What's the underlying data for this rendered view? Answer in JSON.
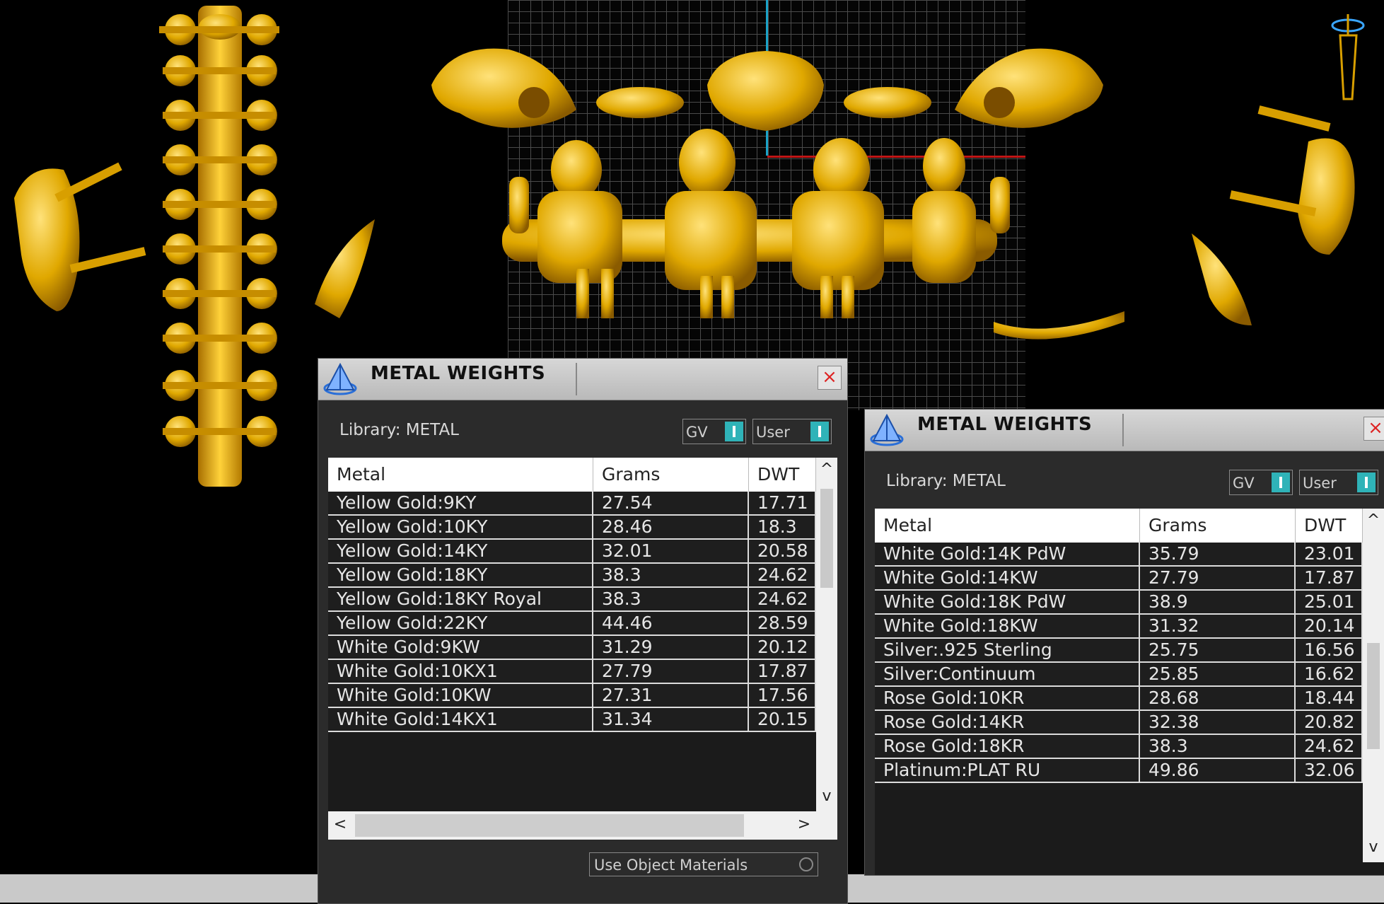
{
  "panels": [
    {
      "title": "METAL WEIGHTS",
      "library": "Library: METAL",
      "toggle_gv": "GV",
      "toggle_user": "User",
      "columns": [
        "Metal",
        "Grams",
        "DWT"
      ],
      "rows": [
        [
          "Yellow Gold:9KY",
          "27.54",
          "17.71"
        ],
        [
          "Yellow Gold:10KY",
          "28.46",
          "18.3"
        ],
        [
          "Yellow Gold:14KY",
          "32.01",
          "20.58"
        ],
        [
          "Yellow Gold:18KY",
          "38.3",
          "24.62"
        ],
        [
          "Yellow Gold:18KY Royal",
          "38.3",
          "24.62"
        ],
        [
          "Yellow Gold:22KY",
          "44.46",
          "28.59"
        ],
        [
          "White Gold:9KW",
          "31.29",
          "20.12"
        ],
        [
          "White Gold:10KX1",
          "27.79",
          "17.87"
        ],
        [
          "White Gold:10KW",
          "27.31",
          "17.56"
        ],
        [
          "White Gold:14KX1",
          "31.34",
          "20.15"
        ]
      ],
      "use_object_materials": "Use Object Materials"
    },
    {
      "title": "METAL WEIGHTS",
      "library": "Library: METAL",
      "toggle_gv": "GV",
      "toggle_user": "User",
      "columns": [
        "Metal",
        "Grams",
        "DWT"
      ],
      "rows": [
        [
          "White Gold:14K PdW",
          "35.79",
          "23.01"
        ],
        [
          "White Gold:14KW",
          "27.79",
          "17.87"
        ],
        [
          "White Gold:18K PdW",
          "38.9",
          "25.01"
        ],
        [
          "White Gold:18KW",
          "31.32",
          "20.14"
        ],
        [
          "Silver:.925 Sterling",
          "25.75",
          "16.56"
        ],
        [
          "Silver:Continuum",
          "25.85",
          "16.62"
        ],
        [
          "Rose Gold:10KR",
          "28.68",
          "18.44"
        ],
        [
          "Rose Gold:14KR",
          "32.38",
          "20.82"
        ],
        [
          "Rose Gold:18KR",
          "38.3",
          "24.62"
        ],
        [
          "Platinum:PLAT RU",
          "49.86",
          "32.06"
        ]
      ]
    }
  ],
  "icons": {
    "panel_icon": "pyramid-icon",
    "close": "close-icon",
    "scroll_up": "chevron-up-icon",
    "scroll_down": "chevron-down-icon",
    "scroll_left": "chevron-left-icon",
    "scroll_right": "chevron-right-icon"
  },
  "colors": {
    "gold": "#e0a800",
    "accent_toggle": "#2fb3b8",
    "axis_blue": "#1aa3c8",
    "axis_red": "#c01616"
  }
}
